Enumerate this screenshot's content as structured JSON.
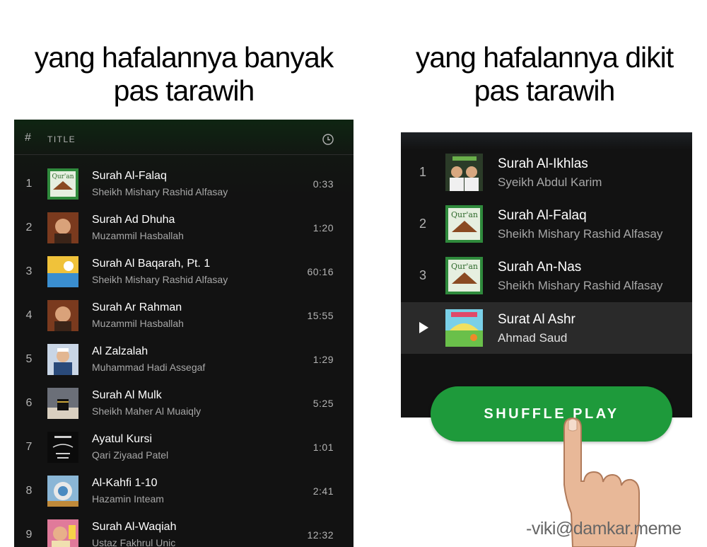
{
  "captions": {
    "left_line1": "yang hafalannya banyak",
    "left_line2": "pas tarawih",
    "right_line1": "yang hafalannya dikit",
    "right_line2": "pas tarawih"
  },
  "left_playlist": {
    "header": {
      "hash": "#",
      "title": "TITLE",
      "duration_icon": "clock-icon"
    },
    "tracks": [
      {
        "num": "1",
        "title": "Surah Al-Falaq",
        "artist": "Sheikh Mishary Rashid Alfasay",
        "duration": "0:33"
      },
      {
        "num": "2",
        "title": "Surah Ad Dhuha",
        "artist": "Muzammil Hasballah",
        "duration": "1:20"
      },
      {
        "num": "3",
        "title": "Surah Al Baqarah, Pt. 1",
        "artist": "Sheikh Mishary Rashid Alfasay",
        "duration": "60:16"
      },
      {
        "num": "4",
        "title": "Surah Ar Rahman",
        "artist": "Muzammil Hasballah",
        "duration": "15:55"
      },
      {
        "num": "5",
        "title": "Al Zalzalah",
        "artist": "Muhammad Hadi Assegaf",
        "duration": "1:29"
      },
      {
        "num": "6",
        "title": "Surah Al Mulk",
        "artist": "Sheikh Maher Al Muaiqly",
        "duration": "5:25"
      },
      {
        "num": "7",
        "title": "Ayatul Kursi",
        "artist": "Qari Ziyaad Patel",
        "duration": "1:01"
      },
      {
        "num": "8",
        "title": "Al-Kahfi 1-10",
        "artist": "Hazamin Inteam",
        "duration": "2:41"
      },
      {
        "num": "9",
        "title": "Surah Al-Waqiah",
        "artist": "Ustaz Fakhrul Unic",
        "duration": "12:32"
      }
    ]
  },
  "right_playlist": {
    "tracks": [
      {
        "num": "1",
        "title": "Surah Al-Ikhlas",
        "artist": "Syeikh Abdul Karim"
      },
      {
        "num": "2",
        "title": "Surah Al-Falaq",
        "artist": "Sheikh Mishary Rashid Alfasay"
      },
      {
        "num": "3",
        "title": "Surah An-Nas",
        "artist": "Sheikh Mishary Rashid Alfasay"
      },
      {
        "num": "",
        "title": "Surat Al Ashr",
        "artist": "Ahmad Saud",
        "state": "active"
      }
    ],
    "shuffle_label": "SHUFFLE PLAY"
  },
  "watermark": "-viki@damkar.meme",
  "colors": {
    "accent": "#1e9a3b",
    "background": "#121212",
    "text_primary": "#ffffff",
    "text_secondary": "#a7a7a7"
  }
}
